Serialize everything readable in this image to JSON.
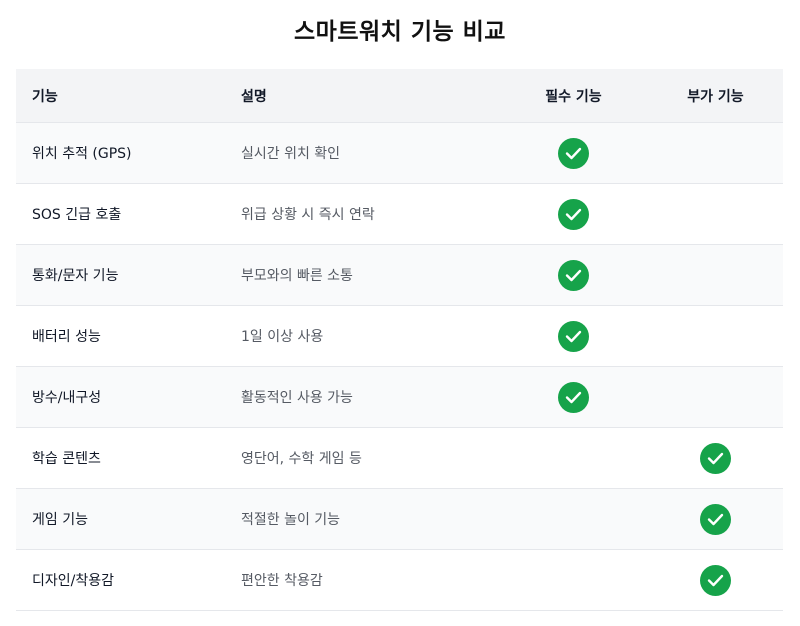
{
  "page": {
    "title": "스마트워치 기능 비교"
  },
  "table": {
    "headers": {
      "feature": "기능",
      "description": "설명",
      "essential": "필수 기능",
      "optional": "부가 기능"
    },
    "rows": [
      {
        "feature": "위치 추적 (GPS)",
        "description": "실시간 위치 확인",
        "essential": true,
        "optional": false
      },
      {
        "feature": "SOS 긴급 호출",
        "description": "위급 상황 시 즉시 연락",
        "essential": true,
        "optional": false
      },
      {
        "feature": "통화/문자 기능",
        "description": "부모와의 빠른 소통",
        "essential": true,
        "optional": false
      },
      {
        "feature": "배터리 성능",
        "description": "1일 이상 사용",
        "essential": true,
        "optional": false
      },
      {
        "feature": "방수/내구성",
        "description": "활동적인 사용 가능",
        "essential": true,
        "optional": false
      },
      {
        "feature": "학습 콘텐츠",
        "description": "영단어, 수학 게임 등",
        "essential": false,
        "optional": true
      },
      {
        "feature": "게임 기능",
        "description": "적절한 놀이 기능",
        "essential": false,
        "optional": true
      },
      {
        "feature": "디자인/착용감",
        "description": "편안한 착용감",
        "essential": false,
        "optional": true
      }
    ]
  },
  "icons": {
    "check": "check-circle-icon"
  },
  "colors": {
    "check_fill": "#16a34a",
    "header_bg": "#f3f4f6",
    "row_alt_bg": "#f9fafb"
  }
}
